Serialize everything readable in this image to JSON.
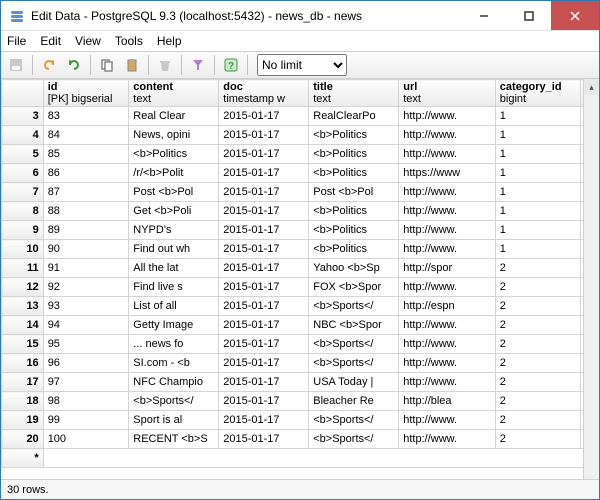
{
  "window": {
    "title": "Edit Data - PostgreSQL 9.3 (localhost:5432) - news_db - news"
  },
  "menu": [
    "File",
    "Edit",
    "View",
    "Tools",
    "Help"
  ],
  "toolbar": {
    "limit_selected": "No limit"
  },
  "columns": [
    {
      "h1": "id",
      "h2": "[PK] bigserial",
      "cls": "col-id"
    },
    {
      "h1": "content",
      "h2": "text",
      "cls": "col-content"
    },
    {
      "h1": "doc",
      "h2": "timestamp w",
      "cls": "col-doc"
    },
    {
      "h1": "title",
      "h2": "text",
      "cls": "col-title"
    },
    {
      "h1": "url",
      "h2": "text",
      "cls": "col-url"
    },
    {
      "h1": "category_id",
      "h2": "bigint",
      "cls": "col-cat"
    }
  ],
  "rows": [
    {
      "n": "3",
      "id": "83",
      "content": "Real Clear ",
      "doc": "2015-01-17",
      "title": "RealClearPo",
      "url": "http://www.",
      "cat": "1"
    },
    {
      "n": "4",
      "id": "84",
      "content": "News, opini",
      "doc": "2015-01-17",
      "title": "<b>Politics",
      "url": "http://www.",
      "cat": "1"
    },
    {
      "n": "5",
      "id": "85",
      "content": "<b>Politics",
      "doc": "2015-01-17",
      "title": "<b>Politics",
      "url": "http://www.",
      "cat": "1"
    },
    {
      "n": "6",
      "id": "86",
      "content": "/r/<b>Polit",
      "doc": "2015-01-17",
      "title": "<b>Politics",
      "url": "https://www",
      "cat": "1"
    },
    {
      "n": "7",
      "id": "87",
      "content": "Post <b>Pol",
      "doc": "2015-01-17",
      "title": "Post <b>Pol",
      "url": "http://www.",
      "cat": "1"
    },
    {
      "n": "8",
      "id": "88",
      "content": "Get <b>Poli",
      "doc": "2015-01-17",
      "title": "<b>Politics",
      "url": "http://www.",
      "cat": "1"
    },
    {
      "n": "9",
      "id": "89",
      "content": "NYPD&#39;s ",
      "doc": "2015-01-17",
      "title": "<b>Politics",
      "url": "http://www.",
      "cat": "1"
    },
    {
      "n": "10",
      "id": "90",
      "content": "Find out wh",
      "doc": "2015-01-17",
      "title": "<b>Politics",
      "url": "http://www.",
      "cat": "1"
    },
    {
      "n": "11",
      "id": "91",
      "content": "All the lat",
      "doc": "2015-01-17",
      "title": "Yahoo <b>Sp",
      "url": "http://spor",
      "cat": "2"
    },
    {
      "n": "12",
      "id": "92",
      "content": "Find live s",
      "doc": "2015-01-17",
      "title": "FOX <b>Spor",
      "url": "http://www.",
      "cat": "2"
    },
    {
      "n": "13",
      "id": "93",
      "content": "List of all",
      "doc": "2015-01-17",
      "title": "<b>Sports</",
      "url": "http://espn",
      "cat": "2"
    },
    {
      "n": "14",
      "id": "94",
      "content": "Getty Image",
      "doc": "2015-01-17",
      "title": "NBC <b>Spor",
      "url": "http://www.",
      "cat": "2"
    },
    {
      "n": "15",
      "id": "95",
      "content": "... news fo",
      "doc": "2015-01-17",
      "title": "<b>Sports</",
      "url": "http://www.",
      "cat": "2"
    },
    {
      "n": "16",
      "id": "96",
      "content": "SI.com - <b",
      "doc": "2015-01-17",
      "title": "<b>Sports</",
      "url": "http://www.",
      "cat": "2"
    },
    {
      "n": "17",
      "id": "97",
      "content": "NFC Champio",
      "doc": "2015-01-17",
      "title": "USA Today |",
      "url": "http://www.",
      "cat": "2"
    },
    {
      "n": "18",
      "id": "98",
      "content": "<b>Sports</",
      "doc": "2015-01-17",
      "title": "Bleacher Re",
      "url": "http://blea",
      "cat": "2"
    },
    {
      "n": "19",
      "id": "99",
      "content": "Sport is al",
      "doc": "2015-01-17",
      "title": "<b>Sports</",
      "url": "http://www.",
      "cat": "2"
    },
    {
      "n": "20",
      "id": "100",
      "content": "RECENT <b>S",
      "doc": "2015-01-17",
      "title": "<b>Sports</",
      "url": "http://www.",
      "cat": "2"
    }
  ],
  "status": "30 rows."
}
